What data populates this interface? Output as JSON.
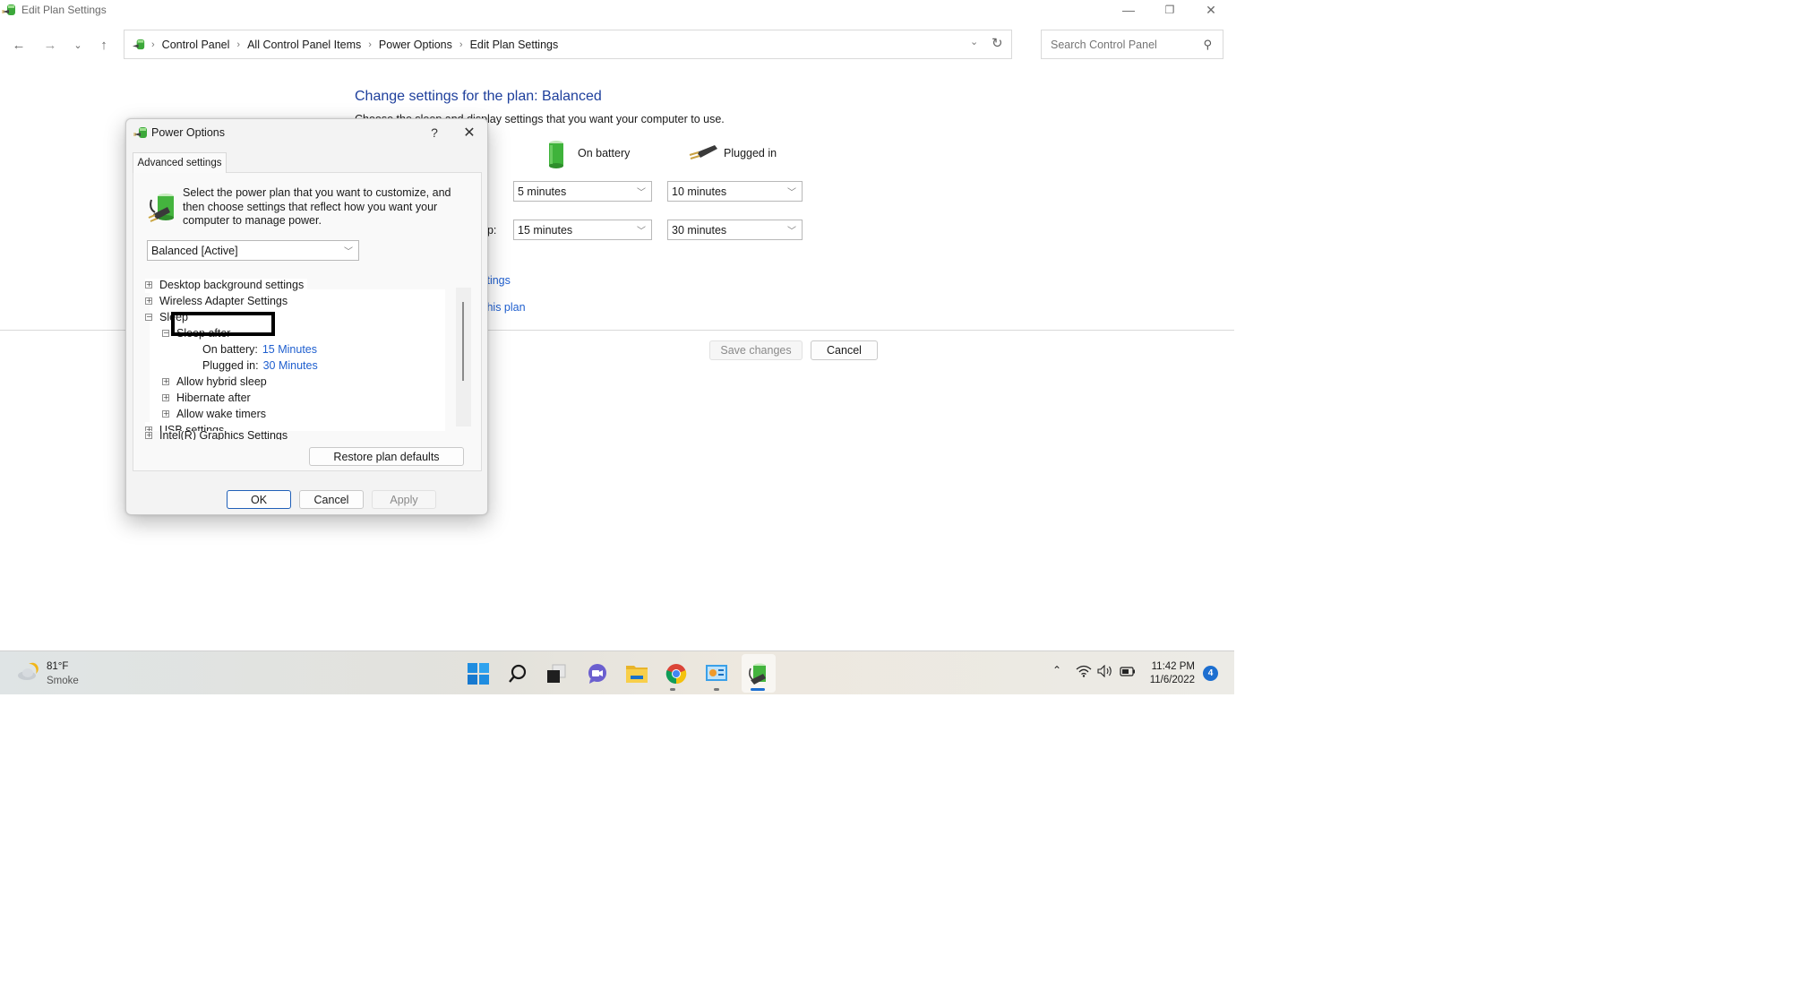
{
  "window": {
    "title": "Edit Plan Settings",
    "minimize_glyph": "—",
    "restore_glyph": "❐",
    "close_glyph": "✕"
  },
  "nav": {
    "back_glyph": "←",
    "forward_glyph": "→",
    "recent_glyph": "⌄",
    "up_glyph": "↑",
    "breadcrumb": [
      "Control Panel",
      "All Control Panel Items",
      "Power Options",
      "Edit Plan Settings"
    ],
    "breadcrumb_sep": "›",
    "dropdown_glyph": "⌄",
    "refresh_glyph": "↻",
    "search_placeholder": "Search Control Panel",
    "search_value": "",
    "search_glyph": "⚲"
  },
  "main": {
    "heading": "Change settings for the plan: Balanced",
    "subtitle": "Choose the sleep and display settings that you want your computer to use.",
    "col_battery": "On battery",
    "col_plugged": "Plugged in",
    "rows": [
      {
        "label_visible": "",
        "battery": "5 minutes",
        "plugged": "10 minutes"
      },
      {
        "label_visible": "ep:",
        "battery": "15 minutes",
        "plugged": "30 minutes"
      }
    ],
    "link_advanced_visible": "ttings",
    "link_restore_visible": "this plan",
    "save_label": "Save changes",
    "cancel_label": "Cancel"
  },
  "dialog": {
    "title": "Power Options",
    "help_glyph": "?",
    "close_glyph": "✕",
    "tab": "Advanced settings",
    "intro": "Select the power plan that you want to customize, and then choose settings that reflect how you want your computer to manage power.",
    "plan_selected": "Balanced [Active]",
    "tree": [
      {
        "label": "Desktop background settings",
        "level": 0,
        "state": "collapsed"
      },
      {
        "label": "Wireless Adapter Settings",
        "level": 0,
        "state": "collapsed"
      },
      {
        "label": "Sleep",
        "level": 0,
        "state": "expanded"
      },
      {
        "label": "Sleep after",
        "level": 1,
        "state": "expanded"
      },
      {
        "label": "On battery:",
        "level": 2,
        "value": "15 Minutes"
      },
      {
        "label": "Plugged in:",
        "level": 2,
        "value": "30 Minutes"
      },
      {
        "label": "Allow hybrid sleep",
        "level": 1,
        "state": "collapsed"
      },
      {
        "label": "Hibernate after",
        "level": 1,
        "state": "collapsed"
      },
      {
        "label": "Allow wake timers",
        "level": 1,
        "state": "collapsed"
      },
      {
        "label": "USB settings",
        "level": 0,
        "state": "collapsed"
      },
      {
        "label": "Intel(R) Graphics Settings",
        "level": 0,
        "state": "collapsed"
      }
    ],
    "restore_label": "Restore plan defaults",
    "ok_label": "OK",
    "cancel_label": "Cancel",
    "apply_label": "Apply"
  },
  "taskbar": {
    "weather_temp": "81°F",
    "weather_condition": "Smoke",
    "apps": [
      "start",
      "search",
      "task-view",
      "teams-chat",
      "file-explorer",
      "chrome",
      "control-panel",
      "power-options"
    ],
    "clock_time": "11:42 PM",
    "clock_date": "11/6/2022",
    "notification_count": "4",
    "tray_chevron": "⌃"
  },
  "colors": {
    "heading_blue": "#1e3f9c",
    "link_blue": "#1f5fcf",
    "notification_blue": "#1d6fd0"
  }
}
